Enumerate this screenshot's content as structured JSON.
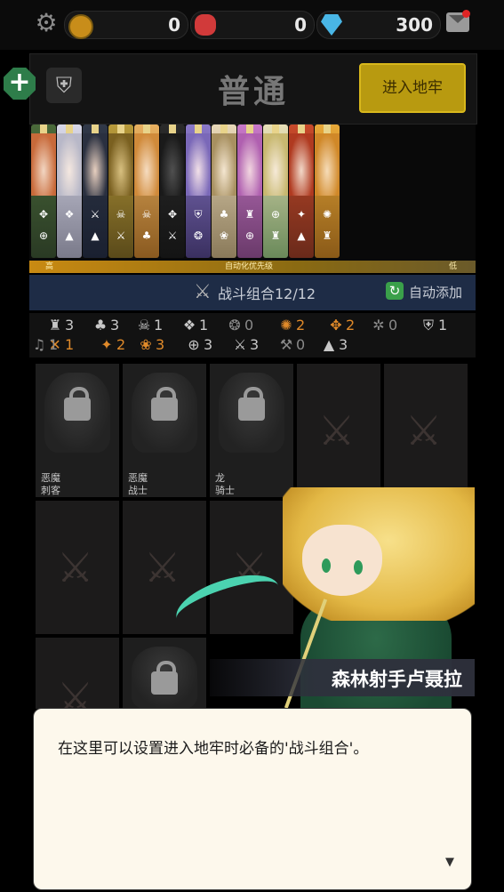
{
  "topbar": {
    "settings_icon": "gear-icon",
    "resources": [
      {
        "name": "gold",
        "icon": "gold-coin-icon",
        "value": "0",
        "color": "#c88d1a"
      },
      {
        "name": "ruby",
        "icon": "red-gem-icon",
        "value": "0",
        "color": "#d13a3a"
      },
      {
        "name": "diamond",
        "icon": "blue-diamond-icon",
        "value": "300",
        "color": "#49b6e6"
      }
    ],
    "mail_icon": "mail-icon"
  },
  "header": {
    "mode_title": "普通",
    "enter_button": "进入地牢"
  },
  "priority_bar": {
    "high": "高",
    "center": "自动化优先级",
    "low": "低"
  },
  "combo_bar": {
    "label": "战斗组合12/12",
    "auto_add": "自动添加"
  },
  "synergies": [
    {
      "icon": "tower-icon",
      "count": "3",
      "color": "#c8c8c8"
    },
    {
      "icon": "mushroom-icon",
      "count": "3",
      "color": "#c8c8c8"
    },
    {
      "icon": "skull-icon",
      "count": "1",
      "color": "#c8c8c8"
    },
    {
      "icon": "dragon-icon",
      "count": "1",
      "color": "#c8c8c8"
    },
    {
      "icon": "demon-icon",
      "count": "0",
      "color": "#8a8a8a"
    },
    {
      "icon": "lion-icon",
      "count": "2",
      "color": "#e08a2a"
    },
    {
      "icon": "paw-icon",
      "count": "2",
      "color": "#e08a2a"
    },
    {
      "icon": "bug-icon",
      "count": "0",
      "color": "#8a8a8a"
    },
    {
      "icon": "shield-icon",
      "count": "1",
      "color": "#c8c8c8"
    },
    {
      "icon": "crossed-blades-icon",
      "count": "1",
      "color": "#e08a2a"
    },
    {
      "icon": "mage-icon",
      "count": "2",
      "color": "#e08a2a"
    },
    {
      "icon": "beast-icon",
      "count": "3",
      "color": "#e08a2a"
    },
    {
      "icon": "crosshair-icon",
      "count": "3",
      "color": "#c8c8c8"
    },
    {
      "icon": "sword-icon",
      "count": "3",
      "color": "#c8c8c8"
    },
    {
      "icon": "axe-icon",
      "count": "0",
      "color": "#8a8a8a"
    },
    {
      "icon": "flame-icon",
      "count": "3",
      "color": "#c8c8c8"
    },
    {
      "icon": "bell-icon",
      "count": "1",
      "color": "#8a8a8a"
    }
  ],
  "team_slots": [
    {
      "state": "locked",
      "tag1": "恶魔",
      "tag2": "刺客"
    },
    {
      "state": "locked",
      "tag1": "恶魔",
      "tag2": "战士"
    },
    {
      "state": "locked",
      "tag1": "龙",
      "tag2": "骑士"
    }
  ],
  "character": {
    "name": "森林射手卢聂拉"
  },
  "dialog": {
    "text": "在这里可以设置进入地牢时必备的'战斗组合'。",
    "next_icon": "▼"
  }
}
